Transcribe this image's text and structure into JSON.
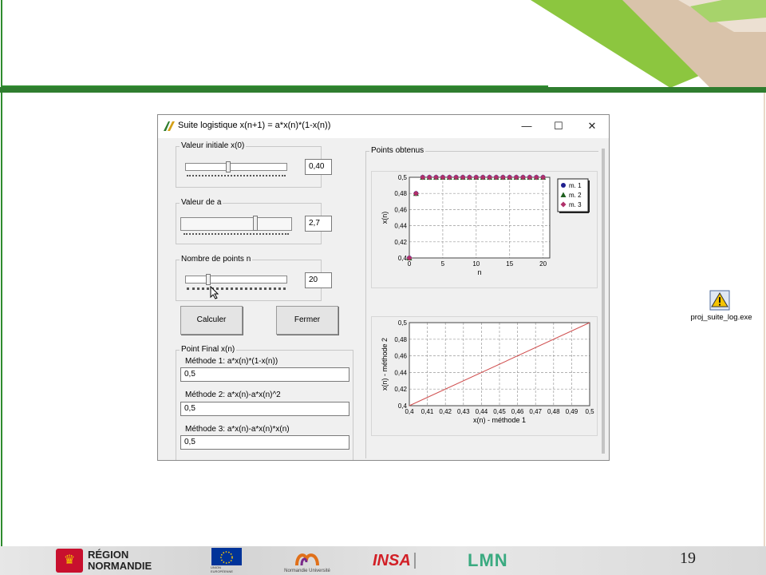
{
  "slide": {
    "page_number": "19",
    "colors": {
      "accent_green": "#2e8b2e",
      "dark_green": "#2f7d2f",
      "light_green": "#8cc63f"
    }
  },
  "footer_logos": [
    {
      "icon": "region-normandie-logo",
      "text": "RÉGION\nNORMANDIE"
    },
    {
      "icon": "eu-flag-logo",
      "text": "UNION EUROPÉENNE"
    },
    {
      "icon": "normandie-universite-logo",
      "text": "Normandie Université"
    },
    {
      "icon": "insa-rouen-logo",
      "text": "INSA"
    },
    {
      "icon": "lmn-logo",
      "text": "LMN"
    }
  ],
  "window": {
    "title": "Suite logistique x(n+1) = a*x(n)*(1-x(n))",
    "controls": {
      "minimize": "—",
      "maximize": "☐",
      "close": "✕"
    }
  },
  "params": {
    "initial": {
      "label": "Valeur initiale  x(0)",
      "value": "0,40",
      "level": 0.4
    },
    "a": {
      "label": "Valeur de a",
      "value": "2,7",
      "level": 0.68
    },
    "points": {
      "label": "Nombre de points  n",
      "value": "20",
      "level": 0.2
    }
  },
  "buttons": {
    "compute": "Calculer",
    "close": "Fermer"
  },
  "final": {
    "label": "Point Final  x(n)",
    "methods": [
      {
        "label": "Méthode 1: a*x(n)*(1-x(n))",
        "value": "0,5"
      },
      {
        "label": "Méthode 2: a*x(n)-a*x(n)^2",
        "value": "0,5"
      },
      {
        "label": "Méthode 3: a*x(n)-a*x(n)*x(n)",
        "value": "0,5"
      }
    ]
  },
  "points_group_label": "Points obtenus",
  "desktop_icon": {
    "icon": "warning-icon",
    "label": "proj_suite_log.exe"
  },
  "chart_data": [
    {
      "type": "scatter",
      "xlabel": "n",
      "ylabel": "x(n)",
      "xlim": [
        0,
        21
      ],
      "ylim": [
        0.4,
        0.5
      ],
      "xticks": [
        "0",
        "5",
        "10",
        "15",
        "20"
      ],
      "yticks": [
        "0,4",
        "0,42",
        "0,44",
        "0,46",
        "0,48",
        "0,5"
      ],
      "legend": [
        "m. 1",
        "m. 2",
        "m. 3"
      ],
      "legend_position": "top-right",
      "grid": true,
      "series": [
        {
          "name": "m. 1",
          "color": "#1f1f8f",
          "marker": "circle",
          "x": [
            0,
            1,
            2,
            3,
            4,
            5,
            6,
            7,
            8,
            9,
            10,
            11,
            12,
            13,
            14,
            15,
            16,
            17,
            18,
            19,
            20
          ],
          "y": [
            0.4,
            0.48,
            0.5,
            0.5,
            0.5,
            0.5,
            0.5,
            0.5,
            0.5,
            0.5,
            0.5,
            0.5,
            0.5,
            0.5,
            0.5,
            0.5,
            0.5,
            0.5,
            0.5,
            0.5,
            0.5
          ]
        },
        {
          "name": "m. 2",
          "color": "#1f5f1f",
          "marker": "triangle",
          "x": [
            0,
            1,
            2,
            3,
            4,
            5,
            6,
            7,
            8,
            9,
            10,
            11,
            12,
            13,
            14,
            15,
            16,
            17,
            18,
            19,
            20
          ],
          "y": [
            0.4,
            0.48,
            0.5,
            0.5,
            0.5,
            0.5,
            0.5,
            0.5,
            0.5,
            0.5,
            0.5,
            0.5,
            0.5,
            0.5,
            0.5,
            0.5,
            0.5,
            0.5,
            0.5,
            0.5,
            0.5
          ]
        },
        {
          "name": "m. 3",
          "color": "#b0306a",
          "marker": "diamond",
          "x": [
            0,
            1,
            2,
            3,
            4,
            5,
            6,
            7,
            8,
            9,
            10,
            11,
            12,
            13,
            14,
            15,
            16,
            17,
            18,
            19,
            20
          ],
          "y": [
            0.4,
            0.48,
            0.5,
            0.5,
            0.5,
            0.5,
            0.5,
            0.5,
            0.5,
            0.5,
            0.5,
            0.5,
            0.5,
            0.5,
            0.5,
            0.5,
            0.5,
            0.5,
            0.5,
            0.5,
            0.5
          ]
        }
      ]
    },
    {
      "type": "line",
      "xlabel": "x(n) - méthode 1",
      "ylabel": "x(n) - méthode 2",
      "xlim": [
        0.4,
        0.5
      ],
      "ylim": [
        0.4,
        0.5
      ],
      "xticks": [
        "0,4",
        "0,41",
        "0,42",
        "0,43",
        "0,44",
        "0,45",
        "0,46",
        "0,47",
        "0,48",
        "0,49",
        "0,5"
      ],
      "yticks": [
        "0,4",
        "0,42",
        "0,44",
        "0,46",
        "0,48",
        "0,5"
      ],
      "grid": true,
      "series": [
        {
          "color": "#d05050",
          "x": [
            0.4,
            0.5
          ],
          "y": [
            0.4,
            0.5
          ]
        }
      ]
    }
  ]
}
